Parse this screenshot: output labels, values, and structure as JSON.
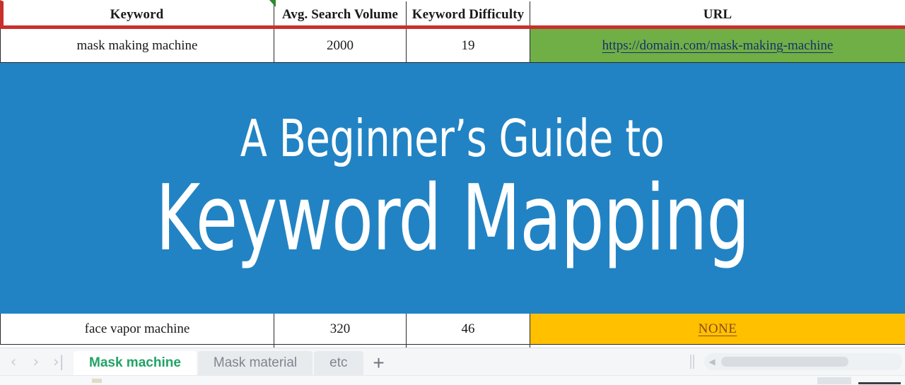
{
  "spreadsheet": {
    "columns": [
      "Keyword",
      "Avg. Search Volume",
      "Keyword Difficulty",
      "URL"
    ],
    "rows": [
      {
        "keyword": "mask making machine",
        "volume": "2000",
        "difficulty": "19",
        "url": "https://domain.com/mask-making-machine",
        "url_fill": "#6faf46"
      },
      {
        "keyword": "face vapor machine",
        "volume": "320",
        "difficulty": "46",
        "url": "NONE",
        "url_fill": "#ffc000"
      }
    ],
    "selection_border_color": "#c9302c",
    "note_marker": "green-comment-triangle"
  },
  "banner": {
    "line1": "A Beginner’s Guide to",
    "line2": "Keyword Mapping",
    "background": "#2183c4",
    "text_color": "#ffffff"
  },
  "tabbar": {
    "nav": {
      "prev": "‹",
      "next": "›",
      "last": "›|"
    },
    "tabs": [
      {
        "label": "Mask machine",
        "active": true
      },
      {
        "label": "Mask material",
        "active": false
      },
      {
        "label": "etc",
        "active": false
      }
    ],
    "add_label": "+",
    "active_tab_color": "#21a366",
    "scroll_arrow": "◀"
  }
}
